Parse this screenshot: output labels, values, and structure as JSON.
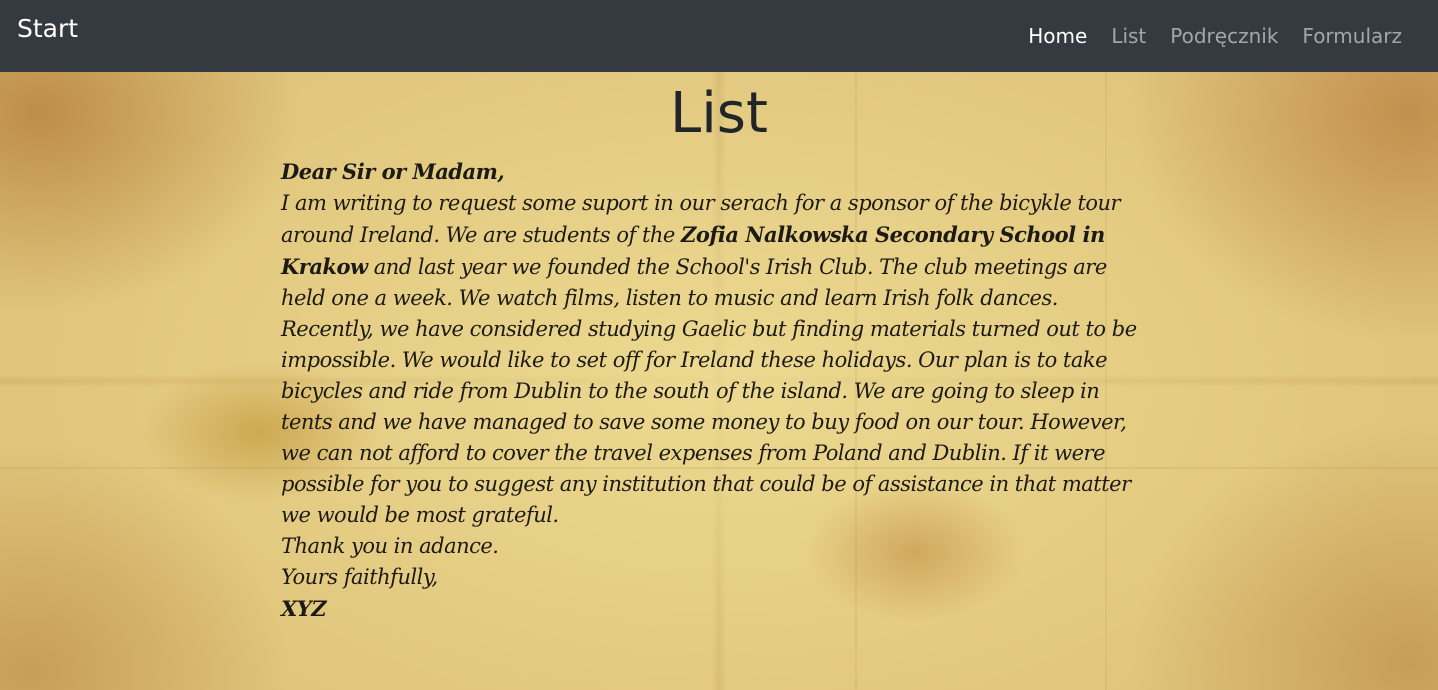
{
  "navbar": {
    "brand": "Start",
    "links": [
      {
        "label": "Home",
        "active": true
      },
      {
        "label": "List",
        "active": false
      },
      {
        "label": "Podręcznik",
        "active": false
      },
      {
        "label": "Formularz",
        "active": false
      }
    ]
  },
  "page": {
    "title": "List"
  },
  "letter": {
    "salutation": "Dear Sir or Madam,",
    "body_part1": "I am writing to request some suport in our serach for a sponsor of the bicykle tour around Ireland. We are students of the ",
    "school_name": "Zofia Nalkowska Secondary School in Krakow",
    "body_part2": " and last year we founded the School's Irish Club. The club meetings are held one a week. We watch films, listen to music and learn Irish folk dances. Recently, we have considered studying Gaelic but finding materials turned out to be impossible. We would like to set off for Ireland these holidays. Our plan is to take bicycles and ride from Dublin to the south of the island. We are going to sleep in tents and we have managed to save some money to buy food on our tour. However, we can not afford to cover the travel expenses from Poland and Dublin. If it were possible for you to suggest any institution that could be of assistance in that matter we would be most grateful.",
    "thanks": "Thank you in adance.",
    "closing": "Yours faithfully,",
    "signature": "XYZ"
  },
  "colors": {
    "navbar_bg": "#343a40",
    "nav_active": "#ffffff",
    "nav_inactive": "rgba(255,255,255,0.55)",
    "title_text": "#212529",
    "letter_text": "#1c1a16"
  }
}
